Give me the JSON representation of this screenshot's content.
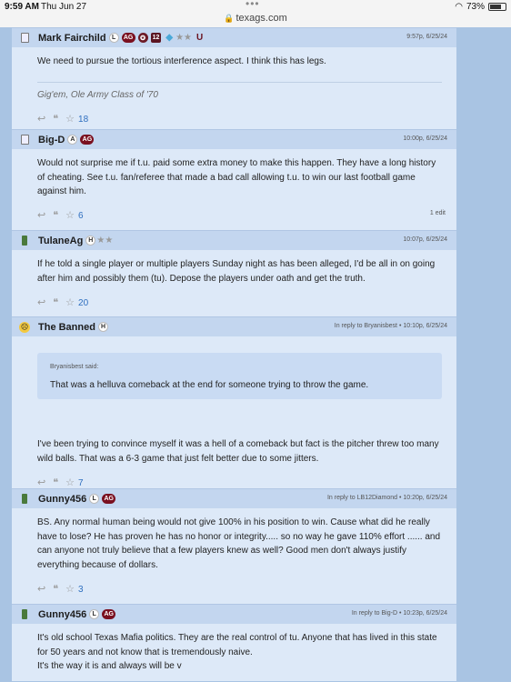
{
  "status_bar": {
    "time": "9:59 AM",
    "date": "Thu Jun 27",
    "dots": "•••",
    "url": "texags.com",
    "battery": "73%",
    "battery_level": 0.73
  },
  "posts": [
    {
      "username": "Mark Fairchild",
      "badges": [
        "L",
        "AG"
      ],
      "meta": "9:57p, 6/25/24",
      "body": "We need to pursue the tortious interference aspect. I think this has legs.",
      "signature": "Gig'em, Ole Army Class of '70",
      "reply_icon": "↩",
      "quote_icon": "❝",
      "star_icon": "★",
      "stars": "18",
      "edit": ""
    },
    {
      "username": "Big-D",
      "badges": [
        "A",
        "AG"
      ],
      "meta": "10:00p, 6/25/24",
      "body": "Would not surprise me if t.u. paid some extra money to make this happen. They have a long history of cheating. See t.u. fan/referee that made a bad call allowing t.u. to win our last football game against him.",
      "stars": "6",
      "edit": "1 edit"
    },
    {
      "username": "TulaneAg",
      "badges": [
        "H"
      ],
      "meta": "10:07p, 6/25/24",
      "body": "If he told a single player or multiple players Sunday night as has been alleged, I'd be all in on going after him and possibly them (tu). Depose the players under oath and get the truth.",
      "stars": "20",
      "edit": ""
    },
    {
      "username": "The Banned",
      "badges": [
        "H"
      ],
      "meta": "In reply to Bryanisbest • 10:10p, 6/25/24",
      "quote_author": "Bryanisbest said:",
      "quote_text": "That was a helluva comeback at the end for someone trying to throw the game.",
      "body": "I've been trying to convince myself it was a hell of a comeback but fact is the pitcher threw too many wild balls. That was a 6-3 game that just felt better due to some jitters.",
      "stars": "7",
      "edit": ""
    },
    {
      "username": "Gunny456",
      "badges": [
        "L",
        "AG"
      ],
      "meta": "In reply to LB12Diamond • 10:20p, 6/25/24",
      "body": "BS. Any normal human being would not give 100% in his position to win. Cause what did he really have to lose? He has proven he has no honor or integrity..... so no way he gave 110% effort ...... and can anyone not truly believe that a few players knew as well? Good men don't always justify everything because of dollars.",
      "stars": "3",
      "edit": ""
    },
    {
      "username": "Gunny456",
      "badges": [
        "L",
        "AG"
      ],
      "meta": "In reply to Big-D • 10:23p, 6/25/24",
      "body_lines": [
        "It's old school Texas Mafia politics. They are the real control of tu. Anyone that has lived in this state for 50 years and not know that is tremendously naive.",
        "It's the way it is and always will be v"
      ]
    }
  ]
}
